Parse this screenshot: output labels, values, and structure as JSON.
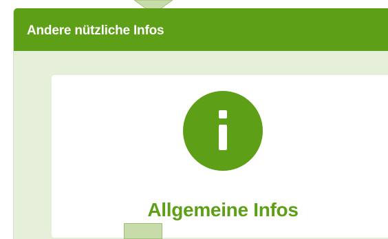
{
  "section": {
    "title": "Andere nützliche Infos"
  },
  "card": {
    "icon": "info-icon",
    "title": "Allgemeine Infos"
  },
  "colors": {
    "accent": "#5d9f16",
    "panel_bg": "#e6efda",
    "card_bg": "#ffffff",
    "connector": "#c8dcaa"
  }
}
